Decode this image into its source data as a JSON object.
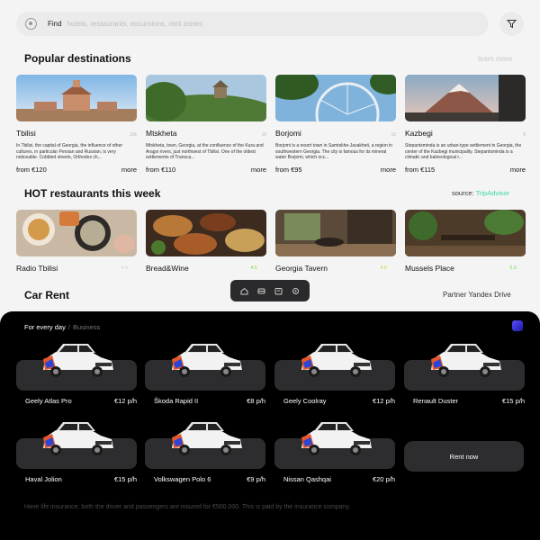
{
  "search": {
    "label": "Find",
    "placeholder": "hotels, restaurants, excursions, rent zones"
  },
  "destinations": {
    "title": "Popular destinations",
    "link": "learn more",
    "items": [
      {
        "name": "Tbilisi",
        "desc": "In Tbilisi, the capital of Georgia, the influence of other cultures, in particular Persian and Russian, is very noticeable. Cobbled streets, Orthodox ch...",
        "price": "from €120",
        "more": "more"
      },
      {
        "name": "Mtskheta",
        "desc": "Mtskheta, town, Georgia, at the confluence of the Kura and Aragvi rivers, just northwest of Tbilisi. One of the oldest settlements of Transca...",
        "price": "from €110",
        "more": "more"
      },
      {
        "name": "Borjomi",
        "desc": "Borjomi is a resort town in Samtskhe-Javakheti, a region in southwestern Georgia. The city is famous for its mineral water Borjomi, which occ...",
        "price": "from €95",
        "more": "more"
      },
      {
        "name": "Kazbegi",
        "desc": "Stepantsminda is an urban-type settlement in Georgia, the center of the Kazbegi municipality. Stepantsminda is a climatic and balneological r...",
        "price": "from €115",
        "more": "more"
      }
    ]
  },
  "restaurants": {
    "title": "HOT restaurants this week",
    "source_label": "source:",
    "source_name": "TripAdvisor",
    "items": [
      {
        "name": "Radio Tbilisi",
        "rating": "4.4"
      },
      {
        "name": "Bread&Wine",
        "rating": "4.5"
      },
      {
        "name": "Georgia Tavern",
        "rating": "4.6"
      },
      {
        "name": "Mussels Place",
        "rating": "5.0"
      }
    ]
  },
  "carrent": {
    "title": "Car Rent",
    "partner": "Partner Yandex Drive",
    "tab_active": "For every day",
    "tab_sep": "/",
    "tab_inactive": "Business",
    "rent_label": "Rent now",
    "insurance": "Have life insurance, both the driver and passengers are insured for €500.000. This is paid by the insurance company.",
    "cars": [
      {
        "name": "Geely Atlas Pro",
        "price": "€12 p/h"
      },
      {
        "name": "Škoda Rapid II",
        "price": "€8 p/h"
      },
      {
        "name": "Geely Coolray",
        "price": "€12 p/h"
      },
      {
        "name": "Renault Duster",
        "price": "€15 p/h"
      },
      {
        "name": "Haval Jolion",
        "price": "€15 p/h"
      },
      {
        "name": "Volkswagen Polo 6",
        "price": "€9 p/h"
      },
      {
        "name": "Nissan Qashqai",
        "price": "€20 p/h"
      }
    ]
  },
  "colors": {
    "accent": "#3fd6a8",
    "rating": "#7bdc3c",
    "rating_yellow": "#c6d93a",
    "dark": "#000000"
  },
  "nav": {
    "icons": [
      "home-icon",
      "car-icon",
      "calendar-icon",
      "settings-icon"
    ]
  }
}
